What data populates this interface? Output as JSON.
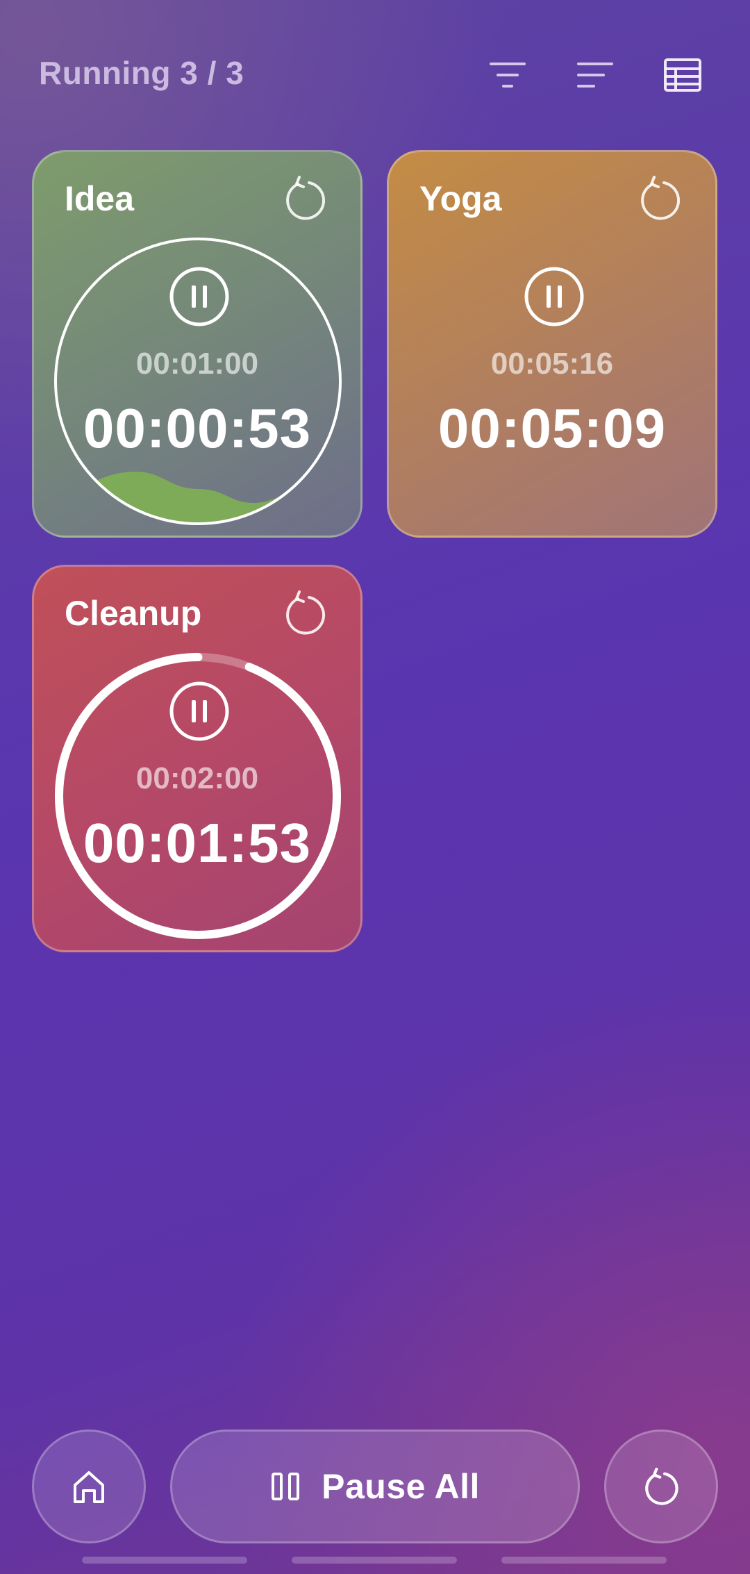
{
  "header": {
    "title": "Running 3 / 3",
    "icons": [
      "filter-icon",
      "sort-icon",
      "table-view-icon"
    ]
  },
  "timers": [
    {
      "name": "Idea",
      "target": "00:01:00",
      "elapsed": "00:00:53",
      "state": "running",
      "ring": "full-with-wave",
      "color": "#7a9a70"
    },
    {
      "name": "Yoga",
      "target": "00:05:16",
      "elapsed": "00:05:09",
      "state": "running",
      "ring": "none",
      "color": "#c08a50"
    },
    {
      "name": "Cleanup",
      "target": "00:02:00",
      "elapsed": "00:01:53",
      "state": "running",
      "ring": "progress",
      "progress": 0.94,
      "color": "#c05060"
    }
  ],
  "bottom_bar": {
    "home_icon": "home-icon",
    "pause_all_label": "Pause All",
    "pause_all_icon": "pause-icon",
    "reset_all_icon": "reset-icon"
  },
  "colors": {
    "background": "#5a35b0",
    "accent_white": "#ffffff",
    "wave_green": "#7eae55"
  }
}
